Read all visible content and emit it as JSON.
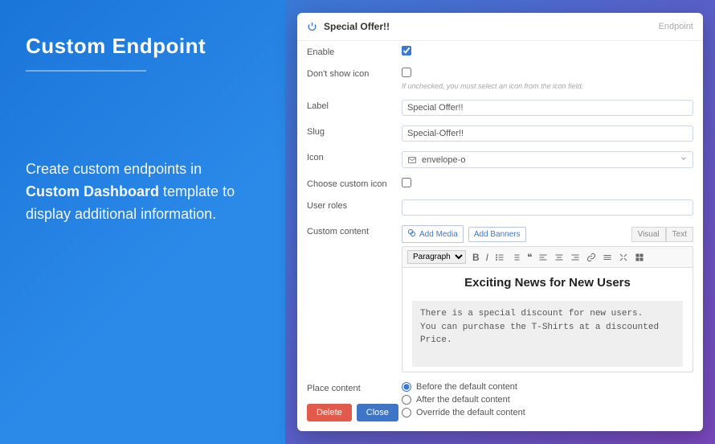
{
  "promo": {
    "title": "Custom Endpoint",
    "desc_line1": "Create custom endpoints in",
    "desc_bold": "Custom Dashboard",
    "desc_line2": " template to",
    "desc_line3": "display additional information."
  },
  "header": {
    "title": "Special Offer!!",
    "breadcrumb": "Endpoint"
  },
  "fields": {
    "enable_label": "Enable",
    "dont_show_label": "Don't show icon",
    "dont_show_hint": "If unchecked, you must select an icon from the icon field.",
    "label_label": "Label",
    "label_value": "Special Offer!!",
    "slug_label": "Slug",
    "slug_value": "Special-Offer!!",
    "icon_label": "Icon",
    "icon_value": "envelope-o",
    "choose_icon_label": "Choose custom icon",
    "user_roles_label": "User roles",
    "custom_content_label": "Custom content",
    "place_content_label": "Place content"
  },
  "editor": {
    "add_media": "Add Media",
    "add_banners": "Add Banners",
    "tab_visual": "Visual",
    "tab_text": "Text",
    "paragraph": "Paragraph",
    "heading": "Exciting News for New Users",
    "body": "There is a special discount for new users.\nYou can purchase the T-Shirts at a discounted Price."
  },
  "place_options": {
    "before": "Before the default content",
    "after": "After the default content",
    "override": "Override the default content"
  },
  "buttons": {
    "delete": "Delete",
    "close": "Close"
  }
}
